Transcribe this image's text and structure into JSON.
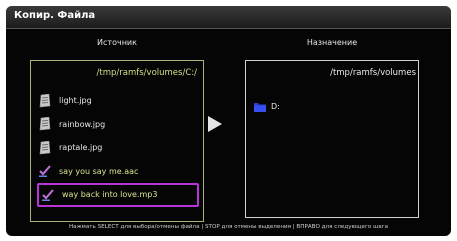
{
  "window": {
    "title": "Копир. Файла"
  },
  "source": {
    "header": "Источник",
    "path": "/tmp/ramfs/volumes/C:/",
    "items": [
      {
        "label": "light.jpg",
        "icon": "image-file-icon",
        "checked": false,
        "selected": false
      },
      {
        "label": "rainbow.jpg",
        "icon": "image-file-icon",
        "checked": false,
        "selected": false
      },
      {
        "label": "raptale.jpg",
        "icon": "image-file-icon",
        "checked": false,
        "selected": false
      },
      {
        "label": "say you say me.aac",
        "icon": "checkmark-icon",
        "checked": true,
        "selected": false
      },
      {
        "label": "way back into love.mp3",
        "icon": "checkmark-icon",
        "checked": true,
        "selected": true
      }
    ]
  },
  "destination": {
    "header": "Назначение",
    "path": "/tmp/ramfs/volumes",
    "items": [
      {
        "label": "D:",
        "icon": "folder-icon"
      }
    ]
  },
  "footer": {
    "hint": "Нажмать SELECT для выбора/отмены файла | STOP для отмены выделения | ВПРАВО для следующего шага"
  },
  "colors": {
    "selection_border": "#b535d6",
    "checked_text": "#dfe58e",
    "folder": "#2a3fd6",
    "checkmark": "#c070e0"
  }
}
